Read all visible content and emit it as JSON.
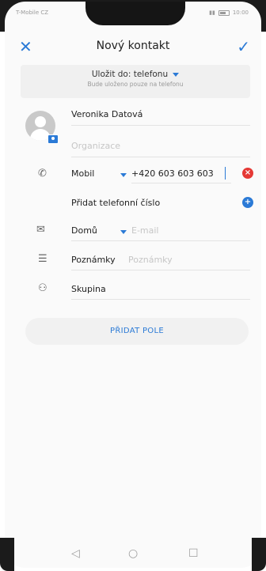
{
  "status_bar": {
    "carrier": "T-Mobile CZ",
    "signal_icon": "signal-icon",
    "battery_icon": "battery-icon",
    "time": "10:00"
  },
  "header": {
    "close_icon": "close-icon",
    "title": "Nový kontakt",
    "confirm_icon": "check-icon"
  },
  "save_location": {
    "label": "Uložit do: telefonu",
    "sub": "Bude uloženo pouze na telefonu"
  },
  "fields": {
    "name": "Veronika Datová",
    "organization_placeholder": "Organizace",
    "phone": {
      "type_label": "Mobil",
      "value": "+420 603 603 603"
    },
    "add_phone_label": "Přidat telefonní číslo",
    "email": {
      "type_label": "Domů",
      "placeholder": "E-mail"
    },
    "notes": {
      "label": "Poznámky",
      "placeholder": "Poznámky"
    },
    "group_label": "Skupina"
  },
  "add_field_button": "PŘIDAT POLE",
  "nav": {
    "back_icon": "back-triangle-icon",
    "home_icon": "home-circle-icon",
    "recent_icon": "recent-square-icon"
  },
  "colors": {
    "accent": "#2b7ad6",
    "remove": "#e53935"
  }
}
